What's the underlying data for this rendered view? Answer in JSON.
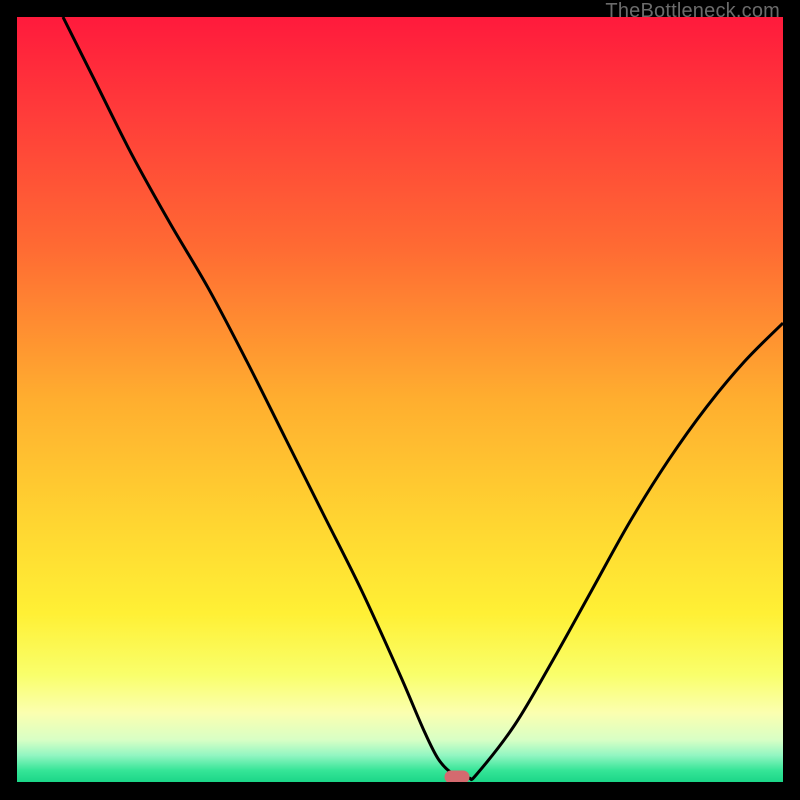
{
  "watermark": "TheBottleneck.com",
  "colors": {
    "marker": "#d46a6f",
    "curve": "#000000",
    "frame": "#000000"
  },
  "chart_data": {
    "type": "line",
    "title": "",
    "xlabel": "",
    "ylabel": "",
    "xlim": [
      0,
      100
    ],
    "ylim": [
      0,
      100
    ],
    "gradient_bg": {
      "stops": [
        {
          "pos": 0.0,
          "color": "#ff1a3c"
        },
        {
          "pos": 0.12,
          "color": "#ff3a3a"
        },
        {
          "pos": 0.3,
          "color": "#ff6a33"
        },
        {
          "pos": 0.5,
          "color": "#ffae2f"
        },
        {
          "pos": 0.66,
          "color": "#ffd531"
        },
        {
          "pos": 0.78,
          "color": "#fff035"
        },
        {
          "pos": 0.86,
          "color": "#f9ff6b"
        },
        {
          "pos": 0.91,
          "color": "#fbffb0"
        },
        {
          "pos": 0.945,
          "color": "#d8ffc5"
        },
        {
          "pos": 0.965,
          "color": "#93f6c2"
        },
        {
          "pos": 0.985,
          "color": "#35e597"
        },
        {
          "pos": 1.0,
          "color": "#1bd688"
        }
      ]
    },
    "series": [
      {
        "name": "bottleneck-curve",
        "x": [
          6,
          10,
          15,
          20,
          25,
          30,
          35,
          40,
          45,
          50,
          53,
          55,
          57,
          59,
          60,
          65,
          70,
          75,
          80,
          85,
          90,
          95,
          100
        ],
        "y": [
          100,
          92,
          82,
          73,
          64.5,
          55,
          45,
          35,
          25,
          14,
          7,
          3,
          1,
          0.5,
          1,
          7.5,
          16,
          25,
          34,
          42,
          49,
          55,
          60
        ]
      }
    ],
    "marker": {
      "x": 57.5,
      "y": 0.7
    }
  }
}
